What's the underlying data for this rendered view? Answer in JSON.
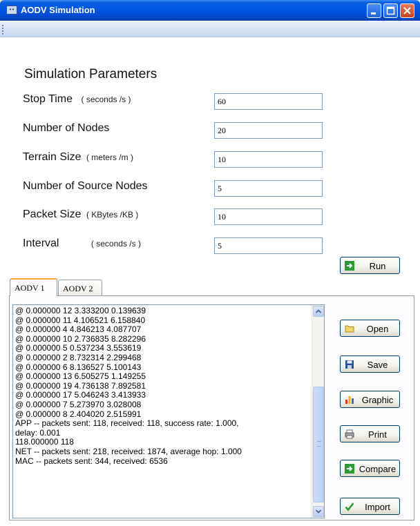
{
  "window": {
    "title": "AODV Simulation",
    "app_icon": "network-icon"
  },
  "params": {
    "heading": "Simulation Parameters",
    "fields": [
      {
        "label": "Stop Time",
        "unit": "( seconds /s )",
        "value": "60"
      },
      {
        "label": "Number of Nodes",
        "unit": "",
        "value": "20"
      },
      {
        "label": "Terrain Size",
        "unit": "( meters /m )",
        "value": "10"
      },
      {
        "label": "Number of Source Nodes",
        "unit": "",
        "value": "5"
      },
      {
        "label": "Packet Size",
        "unit": "( KBytes /KB )",
        "value": "10"
      },
      {
        "label": "Interval",
        "unit": "( seconds /s )",
        "value": "5"
      }
    ]
  },
  "buttons": {
    "run": "Run",
    "open": "Open",
    "save": "Save",
    "graphic": "Graphic",
    "print": "Print",
    "compare": "Compare",
    "import": "Import"
  },
  "tabs": [
    {
      "label": "AODV 1",
      "active": true
    },
    {
      "label": "AODV 2",
      "active": false
    }
  ],
  "log": {
    "lines": [
      "@ 0.000000 12 3.333200 0.139639",
      "@ 0.000000 11 4.106521 6.158840",
      "@ 0.000000 4 4.846213 4.087707",
      "@ 0.000000 10 2.736835 8.282296",
      "@ 0.000000 5 0.537234 3.553619",
      "@ 0.000000 2 8.732314 2.299468",
      "@ 0.000000 6 8.136527 5.100143",
      "@ 0.000000 13 6.505275 1.149255",
      "@ 0.000000 19 4.736138 7.892581",
      "@ 0.000000 17 5.046243 3.413933",
      "@ 0.000000 7 5.273970 3.028008",
      "@ 0.000000 8 2.404020 2.515991",
      "APP -- packets sent: 118, received: 118, success rate: 1.000,",
      "delay: 0.001",
      "118.000000 118",
      "NET -- packets sent: 218, received: 1874, average hop: 1.000",
      "MAC -- packets sent: 344, received: 6536"
    ]
  },
  "colors": {
    "titlebar": "#0055e5",
    "active_tab_accent": "#f5a623",
    "button_border": "#003c74"
  }
}
